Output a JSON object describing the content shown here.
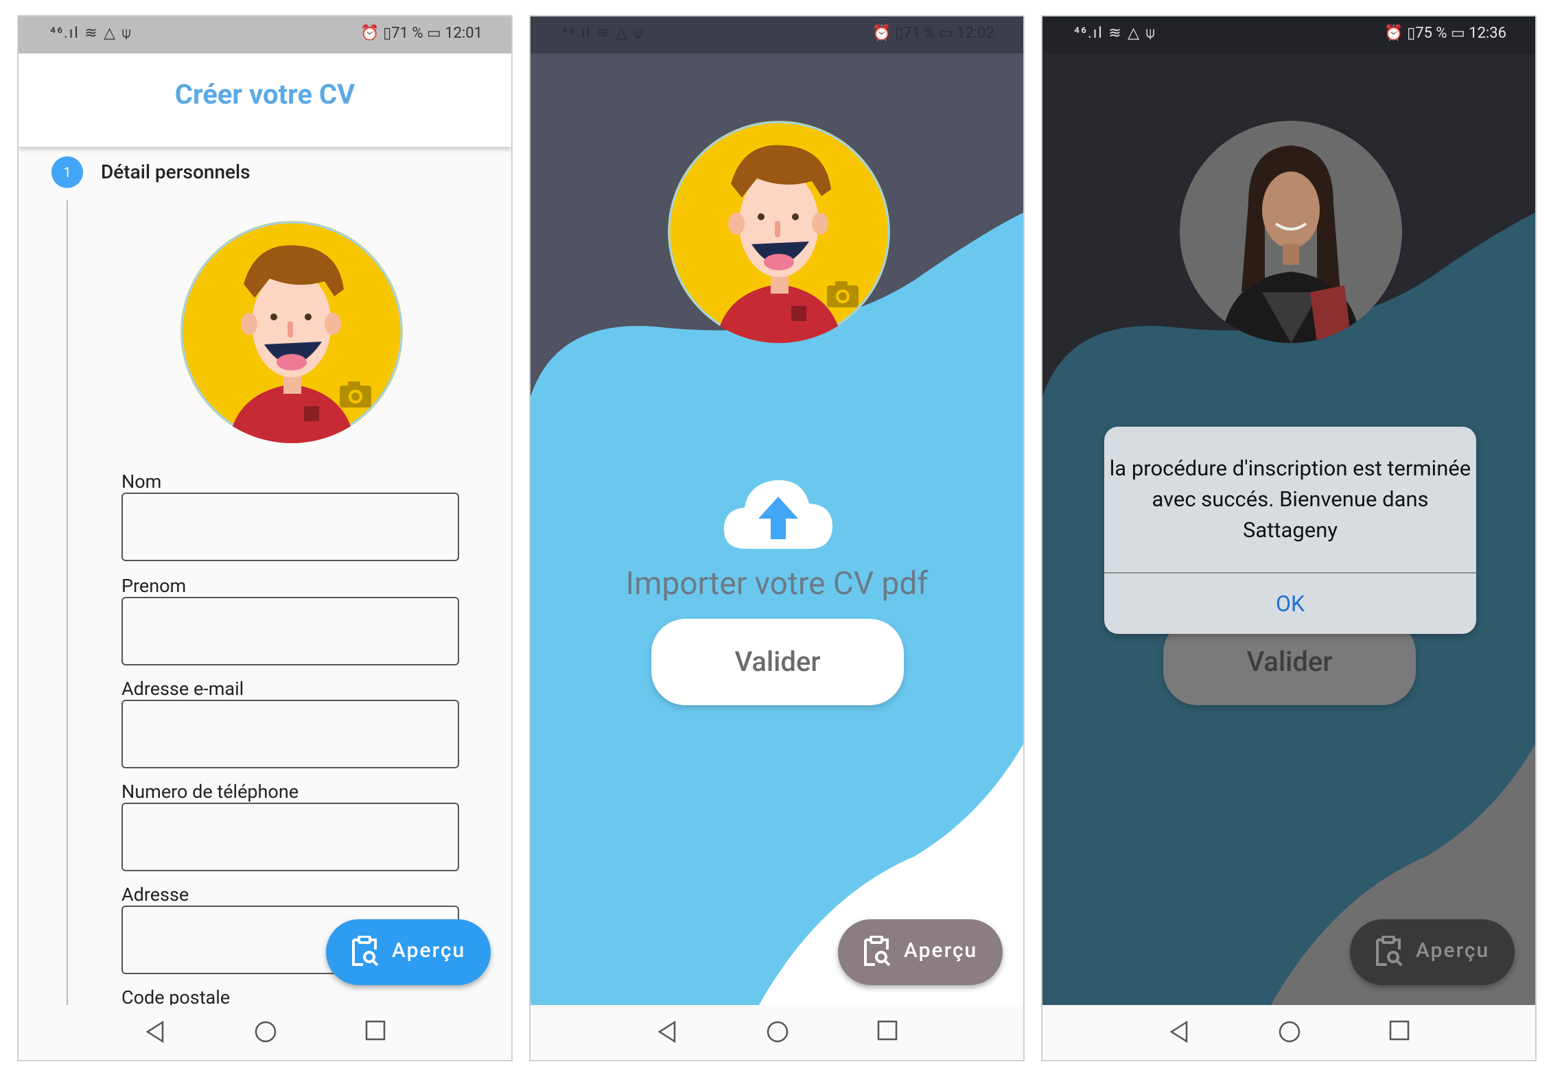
{
  "screens": [
    {
      "status": {
        "left": "⁴⁶.ıl ≋ △ ⍦",
        "battery_text": "⏰ ▯71 % ▭ 12:01"
      },
      "appbar_title": "Créer votre CV",
      "step": {
        "number": "1",
        "title": "Détail personnels"
      },
      "fields": [
        {
          "label": "Nom",
          "value": ""
        },
        {
          "label": "Prenom",
          "value": ""
        },
        {
          "label": "Adresse e-mail",
          "value": ""
        },
        {
          "label": "Numero de téléphone",
          "value": ""
        },
        {
          "label": "Adresse",
          "value": ""
        },
        {
          "label": "Code postale",
          "value": ""
        }
      ],
      "fab_label": "Aperçu"
    },
    {
      "status": {
        "left": "⁴⁶.ıl ≋ △ ⍦",
        "battery_text": "⏰ ▯71 % ▭ 12:02"
      },
      "upload_text": "Importer votre CV pdf",
      "valider_label": "Valider",
      "fab_label": "Aperçu"
    },
    {
      "status": {
        "left": "⁴⁶.ıl ≋ △ ⍦",
        "battery_text": "⏰ ▯75 % ▭ 12:36"
      },
      "dialog_message": "la procédure d'inscription est terminée avec succés. Bienvenue dans Sattageny",
      "dialog_ok": "OK",
      "valider_label": "Valider",
      "fab_label": "Aperçu"
    }
  ],
  "colors": {
    "accent_blue": "#42a5f5",
    "title_blue": "#5aa9e6",
    "wave_blue": "#6ac8ef",
    "dark_bg": "#4f5362",
    "fab_grey": "#8b7e80"
  }
}
